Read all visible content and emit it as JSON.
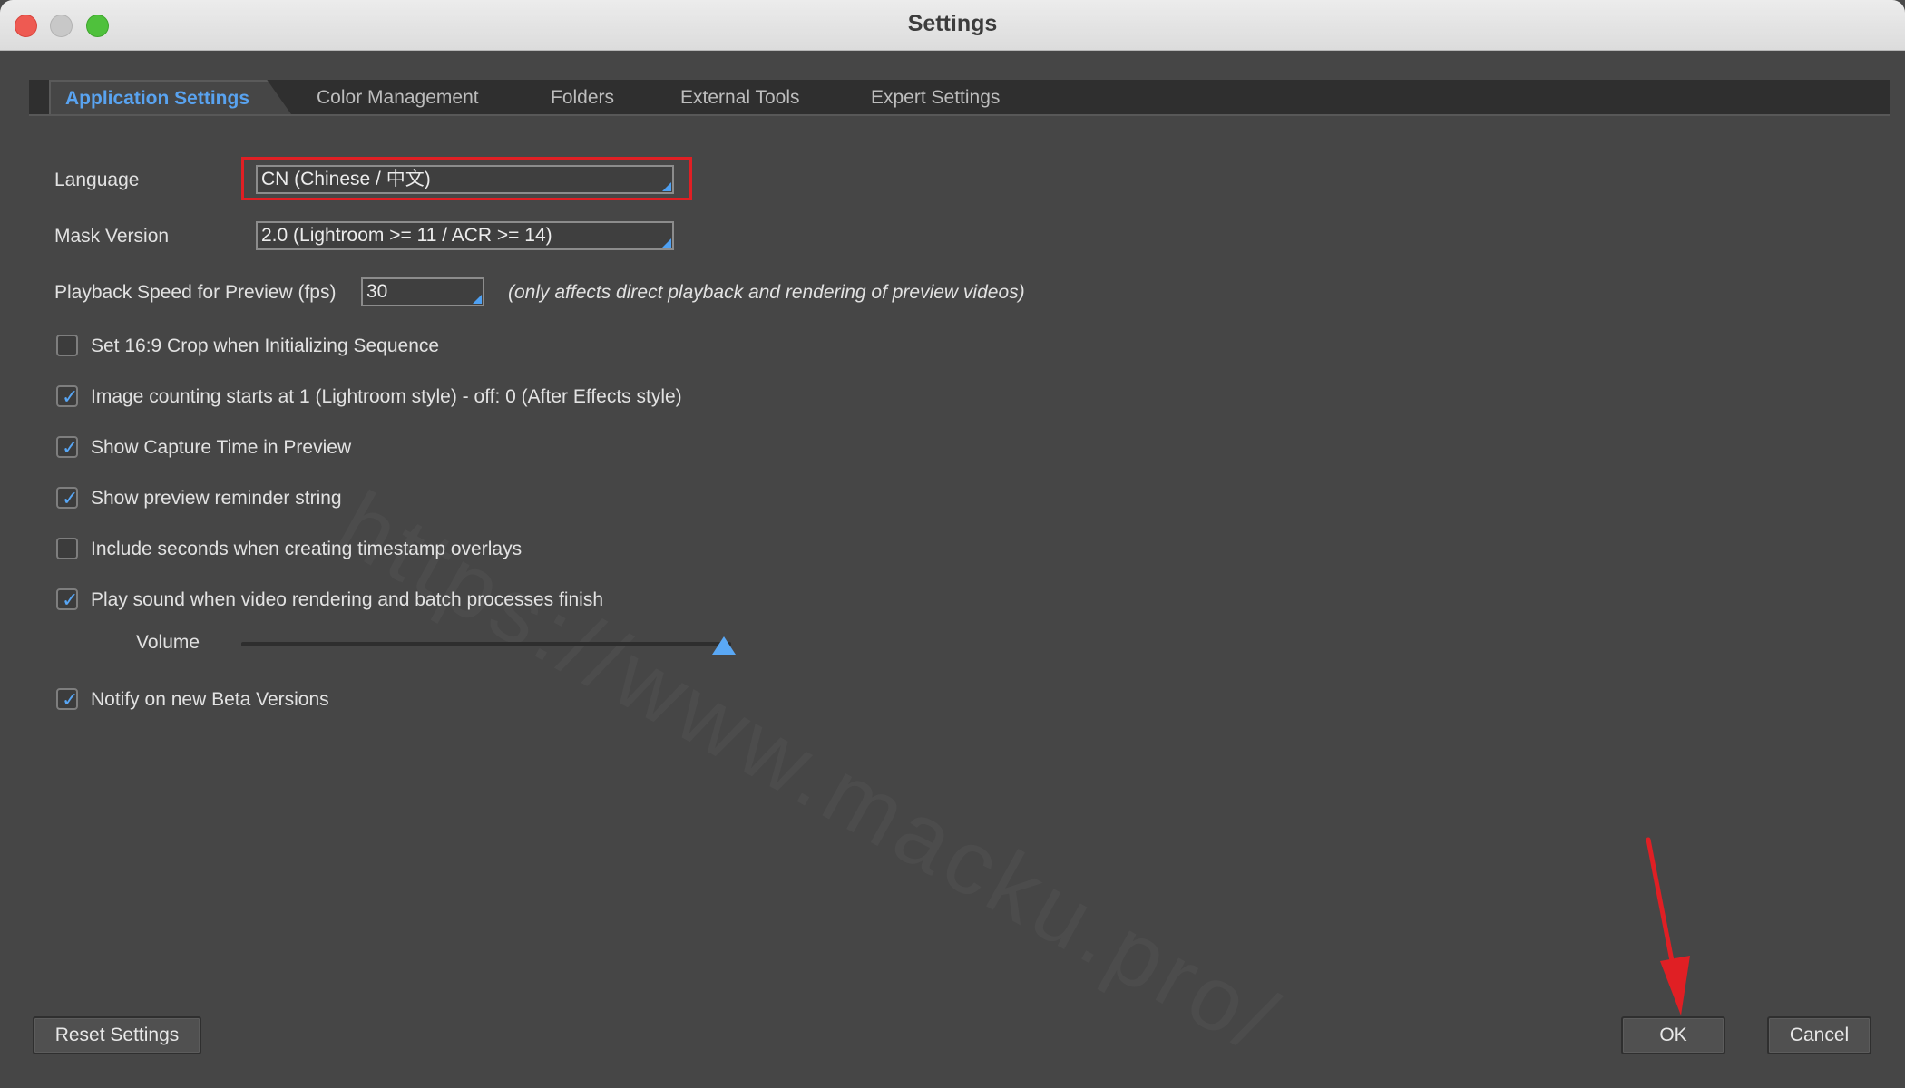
{
  "window": {
    "title": "Settings"
  },
  "watermark": "https://www.macku.pro/",
  "tabs": [
    {
      "label": "Application Settings",
      "active": true
    },
    {
      "label": "Color Management",
      "active": false
    },
    {
      "label": "Folders",
      "active": false
    },
    {
      "label": "External Tools",
      "active": false
    },
    {
      "label": "Expert Settings",
      "active": false
    }
  ],
  "form": {
    "language": {
      "label": "Language",
      "value": "CN (Chinese / 中文)"
    },
    "mask_version": {
      "label": "Mask Version",
      "value": "2.0 (Lightroom >= 11 / ACR >= 14)"
    },
    "playback": {
      "label": "Playback Speed for Preview (fps)",
      "value": "30",
      "note": "(only affects direct playback and rendering of preview videos)"
    },
    "checkboxes": [
      {
        "label": "Set 16:9 Crop when Initializing Sequence",
        "checked": false
      },
      {
        "label": "Image counting starts at 1 (Lightroom style) - off: 0 (After Effects style)",
        "checked": true
      },
      {
        "label": "Show Capture Time in Preview",
        "checked": true
      },
      {
        "label": "Show preview reminder string",
        "checked": true
      },
      {
        "label": "Include seconds when creating timestamp overlays",
        "checked": false
      },
      {
        "label": "Play sound when video rendering and batch processes finish",
        "checked": true
      }
    ],
    "volume": {
      "label": "Volume",
      "level": 1.0
    },
    "beta": {
      "label": "Notify on new Beta Versions",
      "checked": true
    }
  },
  "buttons": {
    "reset": "Reset Settings",
    "ok": "OK",
    "cancel": "Cancel"
  },
  "colors": {
    "accent": "#59a3f0",
    "highlight_border": "#e01f24",
    "background": "#464646"
  },
  "icons": {
    "check": "✓"
  }
}
